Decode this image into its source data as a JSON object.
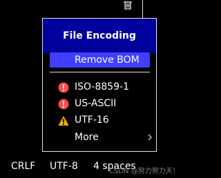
{
  "menu": {
    "title": "File Encoding",
    "primary_action": {
      "label": "Remove BOM"
    },
    "items": [
      {
        "label": "ISO-8859-1",
        "icon": "error-icon",
        "color": "#ff4a4a"
      },
      {
        "label": "US-ASCII",
        "icon": "error-icon",
        "color": "#ff4a4a"
      },
      {
        "label": "UTF-16",
        "icon": "warning-icon",
        "color": "#ffb000"
      },
      {
        "label": "More",
        "icon": "chevron-right-icon"
      }
    ]
  },
  "statusbar": {
    "line_ending": "CRLF",
    "encoding": "UTF-8",
    "indent": "4 spaces"
  },
  "watermark": "CSDN @努力努力天！",
  "colors": {
    "header_bg": "#00009c",
    "highlight_bg": "#3f3fff",
    "border": "#e6e6e6",
    "error": "#ff4a4a",
    "warning": "#ffb000"
  }
}
